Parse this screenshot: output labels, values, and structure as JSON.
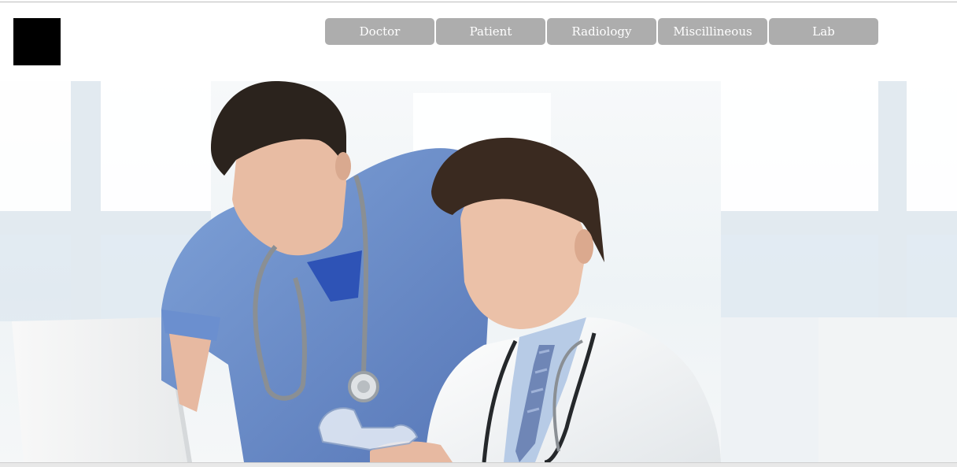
{
  "nav": {
    "items": [
      {
        "label": "Doctor"
      },
      {
        "label": "Patient"
      },
      {
        "label": "Radiology"
      },
      {
        "label": "Miscillineous"
      },
      {
        "label": "Lab"
      }
    ]
  },
  "hero": {
    "image": "two-doctors-at-laptop-photo"
  },
  "colors": {
    "nav_button_bg": "#adadad",
    "nav_button_text": "#ffffff",
    "logo": "#000000",
    "scrubs": "#6b8fcf",
    "coat": "#f1f3f5"
  }
}
